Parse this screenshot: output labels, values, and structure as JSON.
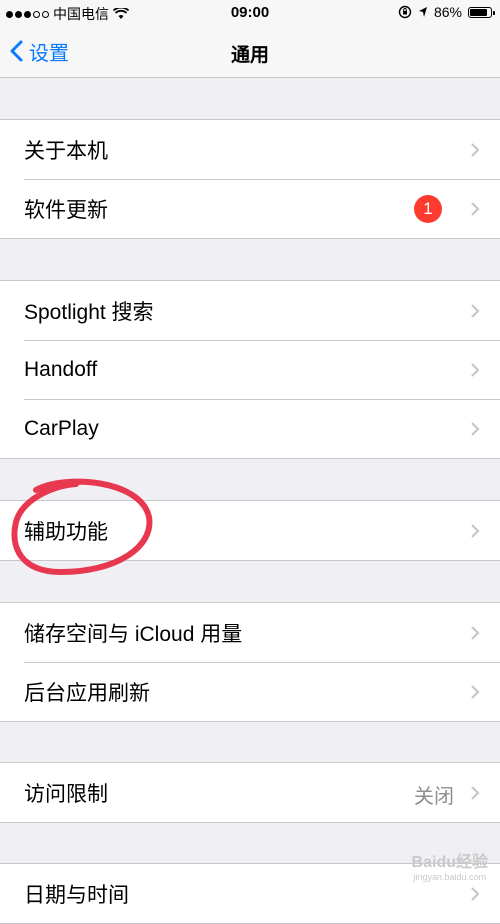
{
  "status": {
    "carrier": "中国电信",
    "time": "09:00",
    "battery": "86%",
    "battery_level": 0.86
  },
  "nav": {
    "back_label": "设置",
    "title": "通用"
  },
  "groups": [
    {
      "rows": [
        {
          "label": "关于本机"
        },
        {
          "label": "软件更新",
          "badge": "1"
        }
      ]
    },
    {
      "rows": [
        {
          "label": "Spotlight 搜索"
        },
        {
          "label": "Handoff"
        },
        {
          "label": "CarPlay"
        }
      ]
    },
    {
      "rows": [
        {
          "label": "辅助功能"
        }
      ]
    },
    {
      "rows": [
        {
          "label": "储存空间与 iCloud 用量"
        },
        {
          "label": "后台应用刷新"
        }
      ]
    },
    {
      "rows": [
        {
          "label": "访问限制",
          "value": "关闭"
        }
      ]
    },
    {
      "rows": [
        {
          "label": "日期与时间"
        }
      ]
    }
  ],
  "watermark": {
    "brand": "Baidu经验",
    "url": "jingyan.baidu.com"
  },
  "colors": {
    "accent": "#0a7aff",
    "badge": "#ff3b30",
    "annotation": "#e8384f"
  }
}
